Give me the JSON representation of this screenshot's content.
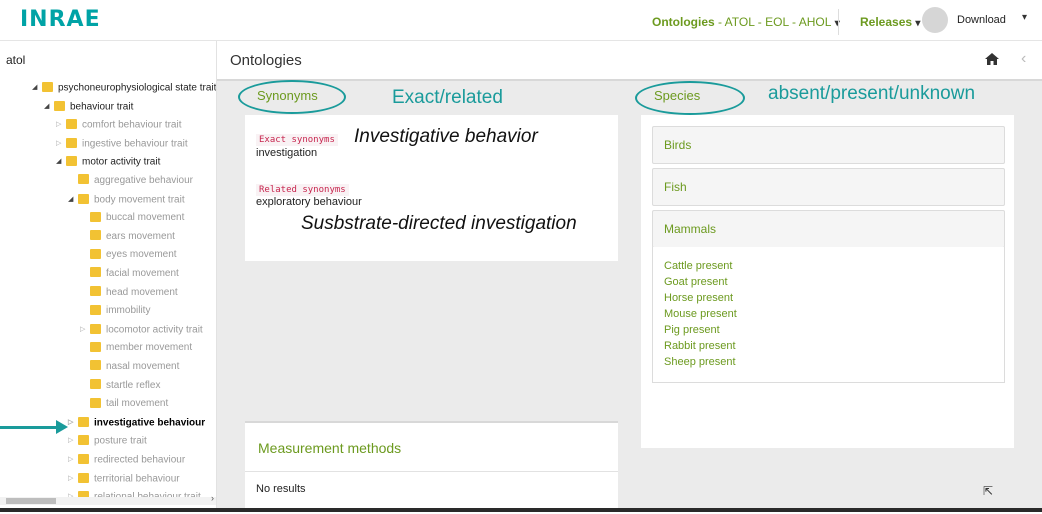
{
  "topbar": {
    "logo": "INRAE",
    "ontologies_label": "Ontologies",
    "ontologies_sub": " - ATOL - EOL - AHOL",
    "releases_label": "Releases",
    "download_label": "Download"
  },
  "sidebar": {
    "search_value": "atol",
    "tree": [
      {
        "label": "psychoneurophysiological state trait",
        "state": "open",
        "dim": false,
        "selected": false
      },
      {
        "label": "behaviour trait",
        "state": "open",
        "dim": false,
        "selected": false
      },
      {
        "label": "comfort behaviour trait",
        "state": "closed",
        "dim": true,
        "selected": false
      },
      {
        "label": "ingestive behaviour trait",
        "state": "closed",
        "dim": true,
        "selected": false
      },
      {
        "label": "motor activity trait",
        "state": "open",
        "dim": false,
        "selected": false
      },
      {
        "label": "aggregative behaviour",
        "state": "leaf",
        "dim": true,
        "selected": false
      },
      {
        "label": "body movement trait",
        "state": "open",
        "dim": true,
        "selected": false
      },
      {
        "label": "buccal movement",
        "state": "leaf",
        "dim": true,
        "selected": false
      },
      {
        "label": "ears movement",
        "state": "leaf",
        "dim": true,
        "selected": false
      },
      {
        "label": "eyes movement",
        "state": "leaf",
        "dim": true,
        "selected": false
      },
      {
        "label": "facial movement",
        "state": "leaf",
        "dim": true,
        "selected": false
      },
      {
        "label": "head movement",
        "state": "leaf",
        "dim": true,
        "selected": false
      },
      {
        "label": "immobility",
        "state": "leaf",
        "dim": true,
        "selected": false
      },
      {
        "label": "locomotor activity trait",
        "state": "closed",
        "dim": true,
        "selected": false
      },
      {
        "label": "member movement",
        "state": "leaf",
        "dim": true,
        "selected": false
      },
      {
        "label": "nasal movement",
        "state": "leaf",
        "dim": true,
        "selected": false
      },
      {
        "label": "startle reflex",
        "state": "leaf",
        "dim": true,
        "selected": false
      },
      {
        "label": "tail movement",
        "state": "leaf",
        "dim": true,
        "selected": false
      },
      {
        "label": "investigative behaviour",
        "state": "closed",
        "dim": false,
        "selected": true
      },
      {
        "label": "posture trait",
        "state": "closed",
        "dim": true,
        "selected": false
      },
      {
        "label": "redirected behaviour",
        "state": "closed",
        "dim": true,
        "selected": false
      },
      {
        "label": "territorial behaviour",
        "state": "closed",
        "dim": true,
        "selected": false
      },
      {
        "label": "relational behaviour trait",
        "state": "closed",
        "dim": true,
        "selected": false
      }
    ]
  },
  "main": {
    "title": "Ontologies",
    "synonyms": {
      "heading": "Synonyms",
      "exact_label": "Exact synonyms",
      "exact_value": "investigation",
      "related_label": "Related synonyms",
      "related_value": "exploratory behaviour"
    },
    "annotations": {
      "exact_related": "Exact/related",
      "investigative": "Investigative behavior",
      "substrate": "Susbstrate-directed investigation",
      "species_note": "absent/present/unknown"
    },
    "species": {
      "heading": "Species",
      "groups": [
        "Birds",
        "Fish",
        "Mammals"
      ],
      "mammals": [
        "Cattle present",
        "Goat present",
        "Horse present",
        "Mouse present",
        "Pig present",
        "Rabbit present",
        "Sheep present"
      ]
    },
    "measurement": {
      "heading": "Measurement methods",
      "empty": "No results"
    }
  },
  "colors": {
    "accent_green": "#6c9a1f",
    "teal": "#1a9b9b",
    "logo": "#00a3a6"
  }
}
